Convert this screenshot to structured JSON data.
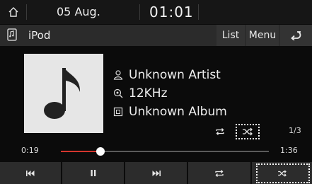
{
  "status": {
    "date": "05 Aug.",
    "time": "01:01"
  },
  "header": {
    "source": "iPod",
    "list_label": "List",
    "menu_label": "Menu"
  },
  "track": {
    "artist": "Unknown Artist",
    "quality": "12KHz",
    "album": "Unknown Album",
    "position": "1/3"
  },
  "playback": {
    "elapsed": "0:19",
    "duration": "1:36",
    "progress_fraction": 0.19,
    "progress_color": "#d4362e"
  },
  "icons": {
    "home": "home-icon",
    "source": "ipod-icon",
    "back": "back-arrow-icon",
    "album_art": "music-note-icon",
    "artist": "person-icon",
    "quality": "sample-rate-icon",
    "album": "album-icon",
    "prev": "previous-track-icon",
    "pause": "pause-icon",
    "next": "next-track-icon",
    "repeat": "repeat-icon",
    "shuffle": "shuffle-icon"
  }
}
